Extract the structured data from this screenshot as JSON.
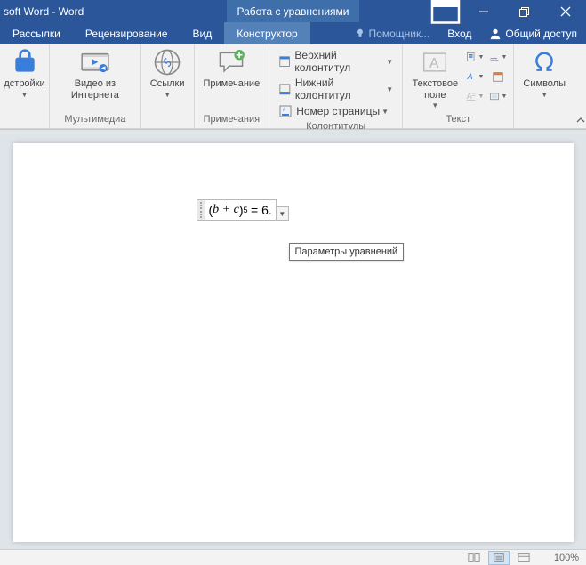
{
  "title": "soft Word - Word",
  "tools_tab": "Работа с уравнениями",
  "tabs": {
    "mailings": "Рассылки",
    "review": "Рецензирование",
    "view": "Вид",
    "design": "Конструктор"
  },
  "tell_me": "Помощник...",
  "signin": "Вход",
  "share": "Общий доступ",
  "ribbon": {
    "g0_btn": "дстройки",
    "multimedia": {
      "video": "Видео из Интернета",
      "label": "Мультимедиа"
    },
    "links": {
      "btn": "Ссылки"
    },
    "comments": {
      "btn": "Примечание",
      "label": "Примечания"
    },
    "headerfooter": {
      "header": "Верхний колонтитул",
      "footer": "Нижний колонтитул",
      "page_no": "Номер страницы",
      "label": "Колонтитулы"
    },
    "text": {
      "textbox": "Текстовое поле",
      "label": "Текст"
    },
    "symbols": {
      "btn": "Символы"
    }
  },
  "equation_text": "(b + c)⁵ = 6.",
  "tooltip": "Параметры уравнений",
  "zoom": "100%"
}
